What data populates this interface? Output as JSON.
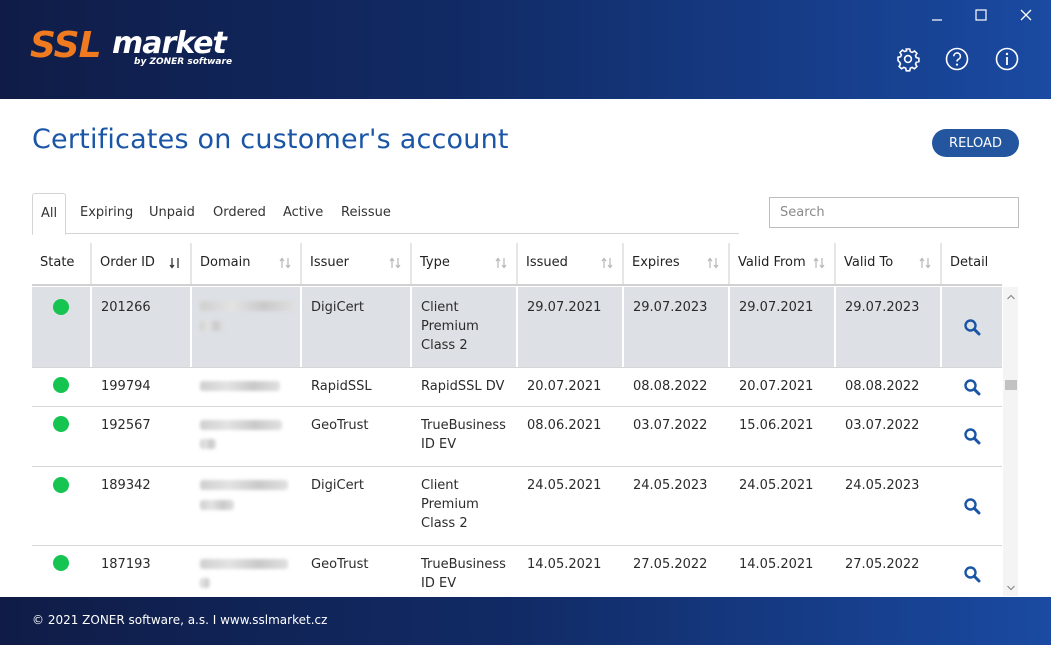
{
  "app": {
    "logo_ssl": "SSL",
    "logo_market": "market",
    "logo_by": "by ZONER software",
    "window_controls": [
      "minimize-icon",
      "maximize-icon",
      "close-icon"
    ],
    "header_icons": [
      "gear-icon",
      "help-icon",
      "info-icon"
    ]
  },
  "page": {
    "title": "Certificates on customer's account",
    "reload_label": "RELOAD"
  },
  "tabs": [
    {
      "label": "All",
      "active": true
    },
    {
      "label": "Expiring",
      "active": false
    },
    {
      "label": "Unpaid",
      "active": false
    },
    {
      "label": "Ordered",
      "active": false
    },
    {
      "label": "Active",
      "active": false
    },
    {
      "label": "Reissue",
      "active": false
    }
  ],
  "search": {
    "placeholder": "Search",
    "value": ""
  },
  "table": {
    "columns": [
      "State",
      "Order ID",
      "Domain",
      "Issuer",
      "Type",
      "Issued",
      "Expires",
      "Valid From",
      "Valid To",
      "Detail"
    ],
    "sorted_column": "Order ID",
    "rows": [
      {
        "state": "active",
        "order_id": "201266",
        "issuer": "DigiCert",
        "type": [
          "Client",
          "Premium",
          "Class 2"
        ],
        "issued": "29.07.2021",
        "expires": "29.07.2023",
        "valid_from": "29.07.2021",
        "valid_to": "29.07.2023",
        "selected": true
      },
      {
        "state": "active",
        "order_id": "199794",
        "issuer": "RapidSSL",
        "type": [
          "RapidSSL DV"
        ],
        "issued": "20.07.2021",
        "expires": "08.08.2022",
        "valid_from": "20.07.2021",
        "valid_to": "08.08.2022",
        "selected": false
      },
      {
        "state": "active",
        "order_id": "192567",
        "issuer": "GeoTrust",
        "type": [
          "TrueBusiness",
          "ID EV"
        ],
        "issued": "08.06.2021",
        "expires": "03.07.2022",
        "valid_from": "15.06.2021",
        "valid_to": "03.07.2022",
        "selected": false
      },
      {
        "state": "active",
        "order_id": "189342",
        "issuer": "DigiCert",
        "type": [
          "Client",
          "Premium",
          "Class 2"
        ],
        "issued": "24.05.2021",
        "expires": "24.05.2023",
        "valid_from": "24.05.2021",
        "valid_to": "24.05.2023",
        "selected": false
      },
      {
        "state": "active",
        "order_id": "187193",
        "issuer": "GeoTrust",
        "type": [
          "TrueBusiness",
          "ID EV"
        ],
        "issued": "14.05.2021",
        "expires": "27.05.2022",
        "valid_from": "14.05.2021",
        "valid_to": "27.05.2022",
        "selected": false
      }
    ]
  },
  "colors": {
    "brand_blue": "#1b56a6",
    "state_active": "#16c451",
    "logo_orange": "#f07a1f",
    "selected_row": "#dde0e5"
  },
  "footer": {
    "text": "© 2021 ZONER software, a.s.  I  www.sslmarket.cz"
  }
}
